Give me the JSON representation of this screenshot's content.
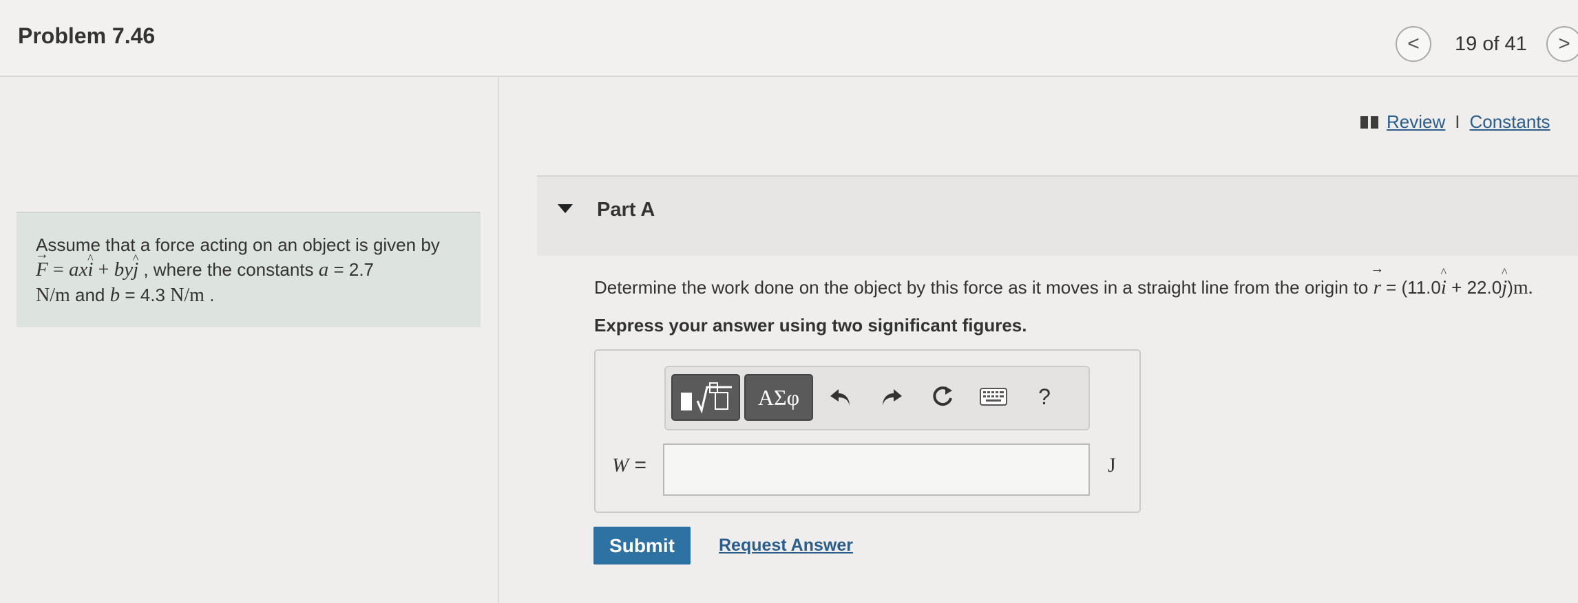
{
  "header": {
    "problem_title": "Problem 7.46",
    "page_count": "19 of 41",
    "prev_glyph": "<",
    "next_glyph": ">"
  },
  "links": {
    "review": "Review",
    "separator": "I",
    "constants": "Constants"
  },
  "problem": {
    "intro": "Assume that a force acting on an object is given by",
    "F": "F",
    "eq": "=",
    "ax": "ax",
    "i": "i",
    "plus": "+",
    "by": "by",
    "j": "j",
    "where_text": ", where the constants",
    "a_sym": "a",
    "a_value": "= 2.7",
    "unit1": "N/m",
    "and_text": "and",
    "b_sym": "b",
    "b_value": "= 4.3",
    "unit2": "N/m",
    "end": "."
  },
  "part": {
    "title": "Part A",
    "question_prefix": "Determine the work done on the object by this force as it moves in a straight line from the origin to",
    "r": "r",
    "r_eq": "= (11.0",
    "i": "i",
    "r_mid": "+ 22.0",
    "j": "j",
    "r_end": ")",
    "r_unit": "m.",
    "instruction": "Express your answer using two significant figures."
  },
  "answer": {
    "greek_label": "ΑΣφ",
    "help_label": "?",
    "variable": "W",
    "equals": "=",
    "value": "",
    "unit": "J"
  },
  "actions": {
    "submit": "Submit",
    "request_answer": "Request Answer"
  }
}
